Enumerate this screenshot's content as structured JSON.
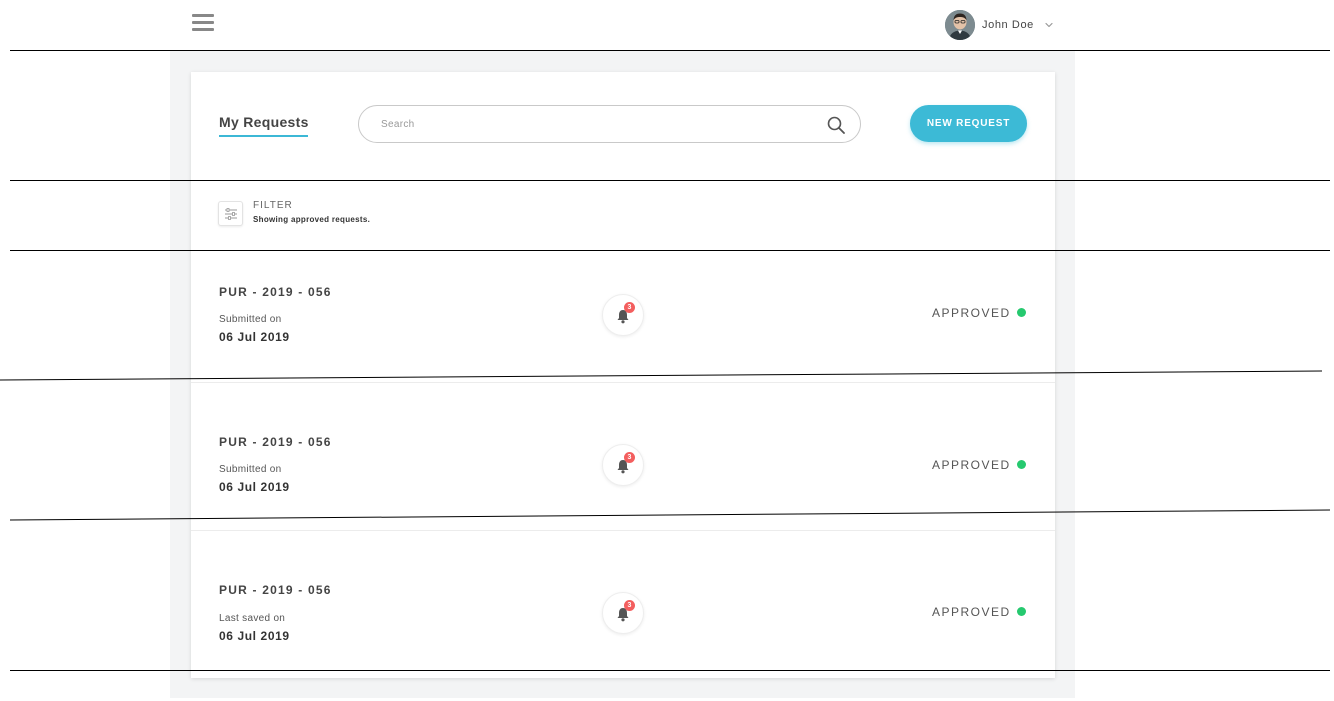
{
  "header": {
    "menu_icon": "hamburger-menu-icon",
    "user": {
      "name": "John Doe",
      "avatar": "user-avatar",
      "dropdown_icon": "chevron-down-icon"
    }
  },
  "main": {
    "title": "My Requests",
    "search": {
      "placeholder": "Search",
      "value": "",
      "icon": "search-icon"
    },
    "new_request_label": "NEW REQUEST",
    "filter": {
      "label": "FILTER",
      "status": "Showing approved requests.",
      "icon": "sliders-icon"
    },
    "requests": [
      {
        "code": "PUR - 2019 - 056",
        "date_label": "Submitted on",
        "date": "06 Jul 2019",
        "notifications": "3",
        "status": "APPROVED"
      },
      {
        "code": "PUR - 2019 - 056",
        "date_label": "Submitted on",
        "date": "06 Jul 2019",
        "notifications": "3",
        "status": "APPROVED"
      },
      {
        "code": "PUR - 2019 - 056",
        "date_label": "Last saved on",
        "date": "06 Jul 2019",
        "notifications": "3",
        "status": "APPROVED"
      }
    ]
  },
  "colors": {
    "accent": "#3cbad6",
    "approved": "#26c96f",
    "badge": "#f35e5e",
    "backdrop": "#f3f4f5"
  }
}
